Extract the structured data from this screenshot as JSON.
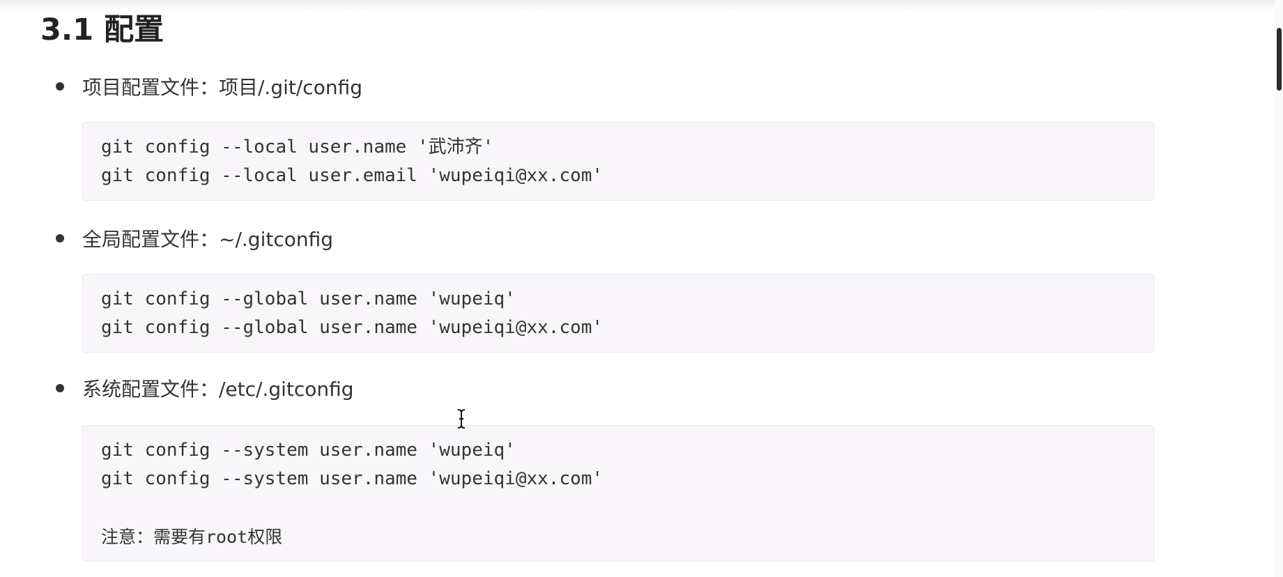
{
  "title": "3.1 配置",
  "sections": [
    {
      "label": "项目配置文件：项目/.git/config",
      "code": [
        "git config --local user.name '武沛齐'",
        "git config --local user.email 'wupeiqi@xx.com'"
      ]
    },
    {
      "label": "全局配置文件：~/.gitconfig",
      "code": [
        "git config --global user.name 'wupeiq'",
        "git config --global user.name 'wupeiqi@xx.com'"
      ]
    },
    {
      "label": "系统配置文件：/etc/.gitconfig",
      "code": [
        "git config --system user.name 'wupeiq'",
        "git config --system user.name 'wupeiqi@xx.com'"
      ],
      "note": "注意：需要有root权限"
    }
  ],
  "icons": {
    "cursor": "text-cursor-icon",
    "bullet": "bullet-dot-icon"
  }
}
